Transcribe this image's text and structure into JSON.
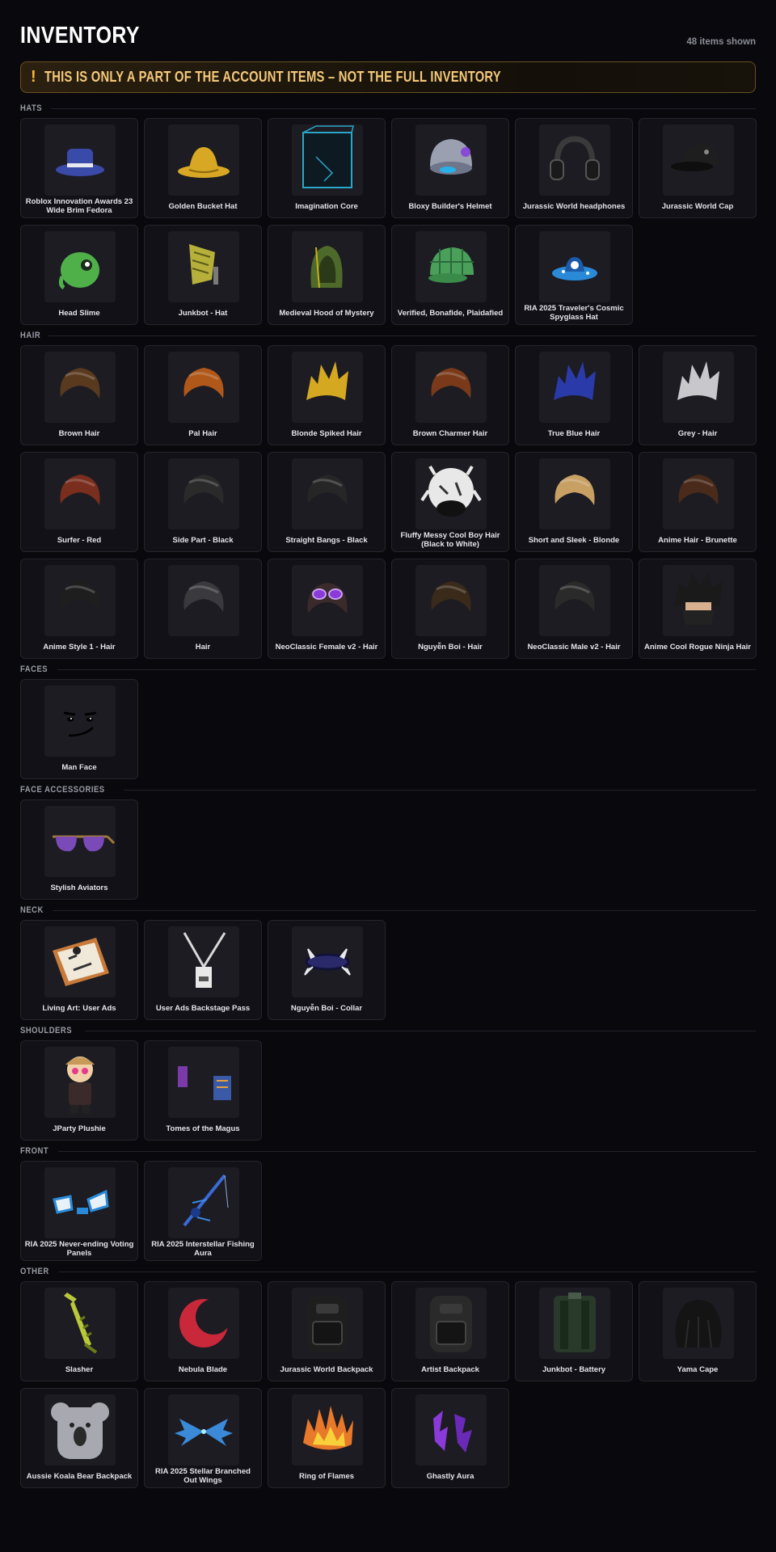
{
  "header": {
    "title": "INVENTORY",
    "count": "48 items shown"
  },
  "warning": {
    "icon": "warning-icon",
    "text": "THIS IS ONLY A PART OF THE ACCOUNT ITEMS – NOT THE FULL INVENTORY",
    "color": "#f5c97a"
  },
  "sections": [
    {
      "label": "HATS",
      "items": [
        {
          "name": "Roblox Innovation Awards 23 Wide Brim Fedora",
          "icon": "fedora-icon",
          "color": "#3a4aa8"
        },
        {
          "name": "Golden Bucket Hat",
          "icon": "hat-icon",
          "color": "#d8a824"
        },
        {
          "name": "Imagination Core",
          "icon": "cube-icon",
          "color": "#2aa6c8"
        },
        {
          "name": "Bloxy Builder's Helmet",
          "icon": "helmet-icon",
          "color": "#9aa0b0"
        },
        {
          "name": "Jurassic World headphones",
          "icon": "headphones-icon",
          "color": "#3a3a3a"
        },
        {
          "name": "Jurassic World Cap",
          "icon": "cap-icon",
          "color": "#1e1e1e"
        },
        {
          "name": "Head Slime",
          "icon": "slime-icon",
          "color": "#4fb04a"
        },
        {
          "name": "Junkbot - Hat",
          "icon": "junk-hat-icon",
          "color": "#b6b03a"
        },
        {
          "name": "Medieval Hood of Mystery",
          "icon": "hood-icon",
          "color": "#4e6a2a"
        },
        {
          "name": "Verified, Bonafide, Plaidafied",
          "icon": "plaid-cap-icon",
          "color": "#4aa05a"
        },
        {
          "name": "RIA 2025 Traveler's Cosmic Spyglass Hat",
          "icon": "cosmic-hat-icon",
          "color": "#2a8ad8"
        }
      ]
    },
    {
      "label": "HAIR",
      "items": [
        {
          "name": "Brown Hair",
          "icon": "hair-icon",
          "color": "#5a3a1e"
        },
        {
          "name": "Pal Hair",
          "icon": "hair-icon",
          "color": "#b0581a"
        },
        {
          "name": "Blonde Spiked Hair",
          "icon": "spiky-hair-icon",
          "color": "#d4a820"
        },
        {
          "name": "Brown Charmer Hair",
          "icon": "hair-icon",
          "color": "#7a3a1a"
        },
        {
          "name": "True Blue Hair",
          "icon": "spiky-hair-icon",
          "color": "#2a3aa8"
        },
        {
          "name": "Grey - Hair",
          "icon": "spiky-hair-icon",
          "color": "#c8c8cc"
        },
        {
          "name": "Surfer - Red",
          "icon": "hair-icon",
          "color": "#7a2e1e"
        },
        {
          "name": "Side Part - Black",
          "icon": "hair-icon",
          "color": "#2a2a2a"
        },
        {
          "name": "Straight Bangs - Black",
          "icon": "hair-icon",
          "color": "#262626"
        },
        {
          "name": "Fluffy Messy Cool Boy Hair (Black to White)",
          "icon": "fluffy-hair-icon",
          "color": "#e8e8e8"
        },
        {
          "name": "Short and Sleek - Blonde",
          "icon": "hair-icon",
          "color": "#c8a064"
        },
        {
          "name": "Anime Hair - Brunette",
          "icon": "hair-icon",
          "color": "#4a2a1a"
        },
        {
          "name": "Anime Style 1 - Hair",
          "icon": "hair-icon",
          "color": "#1e1e1e"
        },
        {
          "name": "Hair",
          "icon": "hair-icon",
          "color": "#3a3a3e"
        },
        {
          "name": "NeoClassic Female v2 - Hair",
          "icon": "glasses-hair-icon",
          "color": "#3a2a2a"
        },
        {
          "name": "Nguyễn Boi - Hair",
          "icon": "hair-icon",
          "color": "#3a2a1a"
        },
        {
          "name": "NeoClassic Male v2 - Hair",
          "icon": "hair-icon",
          "color": "#2a2a2a"
        },
        {
          "name": "Anime Cool Rogue Ninja Hair",
          "icon": "ninja-hair-icon",
          "color": "#1a1a1a"
        }
      ]
    },
    {
      "label": "FACES",
      "items": [
        {
          "name": "Man Face",
          "icon": "face-icon",
          "color": "#000000"
        }
      ]
    },
    {
      "label": "FACE ACCESSORIES",
      "items": [
        {
          "name": "Stylish Aviators",
          "icon": "aviators-icon",
          "color": "#7a4ab8"
        }
      ]
    },
    {
      "label": "NECK",
      "items": [
        {
          "name": "Living Art: User Ads",
          "icon": "painting-icon",
          "color": "#c87a3a"
        },
        {
          "name": "User Ads Backstage Pass",
          "icon": "lanyard-icon",
          "color": "#d8d8d8"
        },
        {
          "name": "Nguyễn Boi - Collar",
          "icon": "collar-icon",
          "color": "#2a2a6a"
        }
      ]
    },
    {
      "label": "SHOULDERS",
      "items": [
        {
          "name": "JParty Plushie",
          "icon": "plushie-icon",
          "color": "#c89a5a"
        },
        {
          "name": "Tomes of the Magus",
          "icon": "books-icon",
          "color": "#3a5aa8"
        }
      ]
    },
    {
      "label": "FRONT",
      "items": [
        {
          "name": "RIA 2025 Never-ending Voting Panels",
          "icon": "panels-icon",
          "color": "#2a8ad8"
        },
        {
          "name": "RIA 2025 Interstellar Fishing Aura",
          "icon": "fishing-rod-icon",
          "color": "#3a6ad8"
        }
      ]
    },
    {
      "label": "OTHER",
      "items": [
        {
          "name": "Slasher",
          "icon": "sword-icon",
          "color": "#b8c83a"
        },
        {
          "name": "Nebula Blade",
          "icon": "crescent-blade-icon",
          "color": "#c8283a"
        },
        {
          "name": "Jurassic World Backpack",
          "icon": "backpack-icon",
          "color": "#1e1e1e"
        },
        {
          "name": "Artist Backpack",
          "icon": "backpack-icon",
          "color": "#2a2a2a"
        },
        {
          "name": "Junkbot - Battery",
          "icon": "battery-icon",
          "color": "#2a3a2a"
        },
        {
          "name": "Yama Cape",
          "icon": "cape-icon",
          "color": "#141414"
        },
        {
          "name": "Aussie Koala Bear Backpack",
          "icon": "koala-icon",
          "color": "#a8a8b0"
        },
        {
          "name": "RIA 2025 Stellar Branched Out Wings",
          "icon": "wings-icon",
          "color": "#3a8ad8"
        },
        {
          "name": "Ring of Flames",
          "icon": "flames-icon",
          "color": "#e8782a"
        },
        {
          "name": "Ghastly Aura",
          "icon": "aura-icon",
          "color": "#8a3ad8"
        }
      ]
    }
  ]
}
